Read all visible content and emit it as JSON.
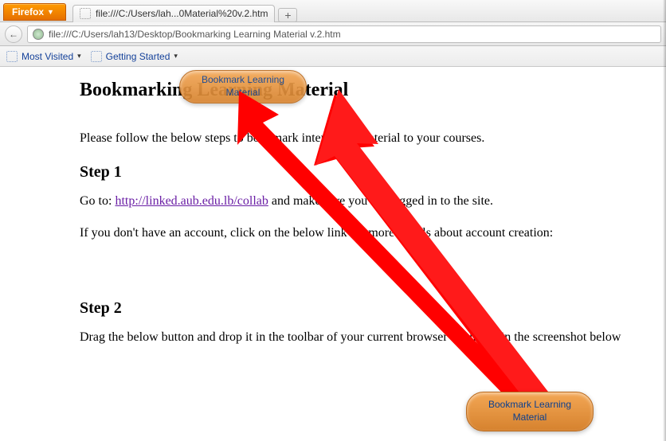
{
  "titlebar": {
    "firefox_label": "Firefox",
    "tab_label": "file:///C:/Users/lah...0Material%20v.2.htm",
    "newtab_label": "+"
  },
  "navbar": {
    "back_glyph": "←",
    "url": "file:///C:/Users/lah13/Desktop/Bookmarking Learning Material v.2.htm"
  },
  "bookmarks": {
    "most_visited": "Most Visited",
    "getting_started": "Getting Started"
  },
  "page": {
    "h1": "Bookmarking Learning Material",
    "intro": "Please follow the below steps to bookmark interesting material to your courses.",
    "step1_h": "Step 1",
    "step1_pre": "Go to: ",
    "step1_link": "http://linked.aub.edu.lb/collab",
    "step1_post": " and make sure you are logged in to the site.",
    "step1_2": "If you don't have an account, click on the below link for more details about account creation:",
    "step2_h": "Step 2",
    "step2_p": "Drag the below button and drop it in the toolbar of your current browser as shown in the screenshot below"
  },
  "bubble": {
    "top": "Bookmark Learning Material",
    "bot": "Bookmark Learning Material"
  }
}
